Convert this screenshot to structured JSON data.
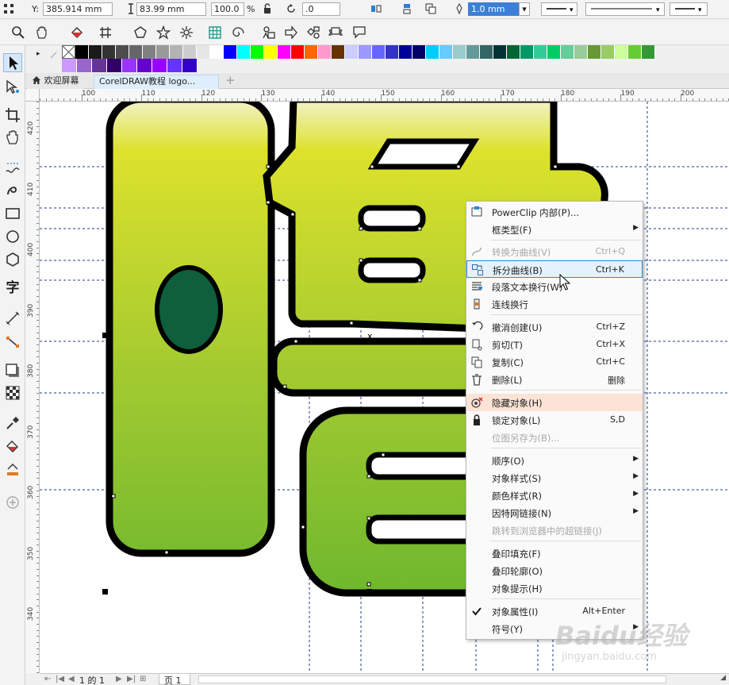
{
  "propbar": {
    "y_label": "Y:",
    "y_value": "385.914 mm",
    "height_value": "83.99 mm",
    "scale_value": "100.0",
    "percent": "%",
    "rotation_value": ".0",
    "outline_width": "1.0 mm"
  },
  "tabs": [
    {
      "label": "欢迎屏幕"
    },
    {
      "label": "CorelDRAW教程 logo..."
    }
  ],
  "hruler": [
    "100",
    "110",
    "120",
    "130",
    "140",
    "150",
    "160",
    "170",
    "180",
    "190",
    "200"
  ],
  "vruler": [
    "420",
    "410",
    "400",
    "390",
    "380",
    "370",
    "360",
    "350",
    "340"
  ],
  "palette": {
    "row1": [
      "#000000",
      "#1a1a1a",
      "#333333",
      "#4d4d4d",
      "#666666",
      "#808080",
      "#999999",
      "#b3b3b3",
      "#cccccc",
      "#e6e6e6",
      "#ffffff",
      "#0000ff",
      "#00ffff",
      "#00ff00",
      "#ffff00",
      "#ff00ff",
      "#ff0000",
      "#ff6600",
      "#ff99cc",
      "#663300",
      "#ccccff",
      "#9999ff",
      "#6666ff",
      "#3333cc",
      "#000099",
      "#000066",
      "#00ccff",
      "#66ccff",
      "#99cccc",
      "#669999",
      "#336666",
      "#003333",
      "#006633",
      "#009966",
      "#33cc99",
      "#00cc66",
      "#66cc99",
      "#99cc99",
      "#669933",
      "#99cc66",
      "#ccff99",
      "#66cc33",
      "#339933"
    ],
    "row2": [
      "#cc99ff",
      "#9966cc",
      "#663399",
      "#330066",
      "#9933ff",
      "#6600cc",
      "#9900ff",
      "#6633ff",
      "#3300cc"
    ]
  },
  "status": {
    "page_of": "1 的 1",
    "page_tab": "页 1"
  },
  "menu": {
    "items": [
      {
        "label": "PowerClip 内部(P)...",
        "shortcut": "",
        "arrow": false,
        "disabled": false
      },
      {
        "label": "框类型(F)",
        "shortcut": "",
        "arrow": true,
        "disabled": false
      },
      {
        "label": "转换为曲线(V)",
        "shortcut": "Ctrl+Q",
        "arrow": false,
        "disabled": true
      },
      {
        "label": "拆分曲线(B)",
        "shortcut": "Ctrl+K",
        "arrow": false,
        "disabled": false
      },
      {
        "label": "段落文本换行(W)",
        "shortcut": "",
        "arrow": false,
        "disabled": false
      },
      {
        "label": "连线换行",
        "shortcut": "",
        "arrow": false,
        "disabled": false
      },
      {
        "label": "撤消创建(U)",
        "shortcut": "Ctrl+Z",
        "arrow": false,
        "disabled": false
      },
      {
        "label": "剪切(T)",
        "shortcut": "Ctrl+X",
        "arrow": false,
        "disabled": false
      },
      {
        "label": "复制(C)",
        "shortcut": "Ctrl+C",
        "arrow": false,
        "disabled": false
      },
      {
        "label": "删除(L)",
        "shortcut": "删除",
        "arrow": false,
        "disabled": false
      },
      {
        "label": "隐藏对象(H)",
        "shortcut": "",
        "arrow": false,
        "disabled": false
      },
      {
        "label": "锁定对象(L)",
        "shortcut": "S,D",
        "arrow": false,
        "disabled": false
      },
      {
        "label": "位图另存为(B)...",
        "shortcut": "",
        "arrow": false,
        "disabled": true
      },
      {
        "label": "顺序(O)",
        "shortcut": "",
        "arrow": true,
        "disabled": false
      },
      {
        "label": "对象样式(S)",
        "shortcut": "",
        "arrow": true,
        "disabled": false
      },
      {
        "label": "颜色样式(R)",
        "shortcut": "",
        "arrow": true,
        "disabled": false
      },
      {
        "label": "因特网链接(N)",
        "shortcut": "",
        "arrow": true,
        "disabled": false
      },
      {
        "label": "跳转到浏览器中的超链接(J)",
        "shortcut": "",
        "arrow": false,
        "disabled": true
      },
      {
        "label": "叠印填充(F)",
        "shortcut": "",
        "arrow": false,
        "disabled": false
      },
      {
        "label": "叠印轮廓(O)",
        "shortcut": "",
        "arrow": false,
        "disabled": false
      },
      {
        "label": "对象提示(H)",
        "shortcut": "",
        "arrow": false,
        "disabled": false
      },
      {
        "label": "对象属性(I)",
        "shortcut": "Alt+Enter",
        "arrow": false,
        "disabled": false
      },
      {
        "label": "符号(Y)",
        "shortcut": "",
        "arrow": true,
        "disabled": false
      }
    ]
  },
  "watermark": {
    "brand": "Baidu经验",
    "url": "jingyan.baidu.com"
  },
  "colors": {
    "accent": "#2a8ad4",
    "logo_green_top": "#d9e02c",
    "logo_green_bottom": "#79bb2e",
    "ellipse": "#0f5e3c"
  }
}
